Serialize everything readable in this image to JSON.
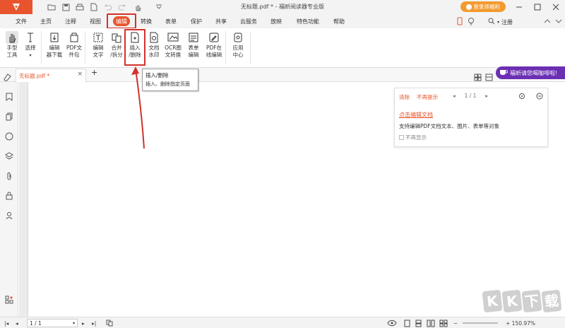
{
  "window": {
    "title": "无标题.pdf * - 福昕阅读器专业版",
    "login_label": "登录领福利"
  },
  "menu": {
    "items": [
      "文件",
      "主页",
      "注释",
      "视图",
      "编辑",
      "转换",
      "表单",
      "保护",
      "共享",
      "云服务",
      "放映",
      "特色功能",
      "帮助"
    ],
    "active_index": 4,
    "search_label": "注册"
  },
  "ribbon": {
    "tools": [
      {
        "label": "手型\n工具",
        "icon": "hand-icon"
      },
      {
        "label": "选择",
        "icon": "cursor-text-icon"
      },
      {
        "label": "编辑\n器下载",
        "icon": "editor-download-icon"
      },
      {
        "label": "PDF文\n件包",
        "icon": "pdf-package-icon"
      },
      {
        "label": "编辑\n文字",
        "icon": "edit-text-icon"
      },
      {
        "label": "合并\n/拆分",
        "icon": "merge-split-icon"
      },
      {
        "label": "插入\n/删除",
        "icon": "insert-delete-icon"
      },
      {
        "label": "文档\n水印",
        "icon": "watermark-icon"
      },
      {
        "label": "OCR图\n文转换",
        "icon": "ocr-icon"
      },
      {
        "label": "表单\n编辑",
        "icon": "form-edit-icon"
      },
      {
        "label": "PDF在\n线编辑",
        "icon": "online-edit-icon"
      },
      {
        "label": "应用\n中心",
        "icon": "app-center-icon"
      }
    ]
  },
  "tabs": {
    "doc_tab_label": "无标题.pdf *",
    "add_label": "+"
  },
  "promo": {
    "label": "福昕请您喝咖啡啦!"
  },
  "tooltip": {
    "title": "插入/删除",
    "description": "插入、删除指定页面"
  },
  "panel": {
    "clear_label": "清除",
    "no_prompt_label": "不再提示",
    "page_indicator": "1 / 1",
    "link_label": "点击编辑文档",
    "description": "支持编辑PDF文档文本、图片、表单等对象",
    "checkbox_label": "不再显示"
  },
  "status": {
    "page_value": "1 / 1",
    "zoom_value": "+ 150.97%"
  },
  "watermark": {
    "chars": [
      "K",
      "K",
      "下",
      "载"
    ]
  },
  "colors": {
    "accent": "#e8542d",
    "highlight": "#d0322b",
    "promo": "#6b2fb3",
    "login": "#f39a2f"
  }
}
